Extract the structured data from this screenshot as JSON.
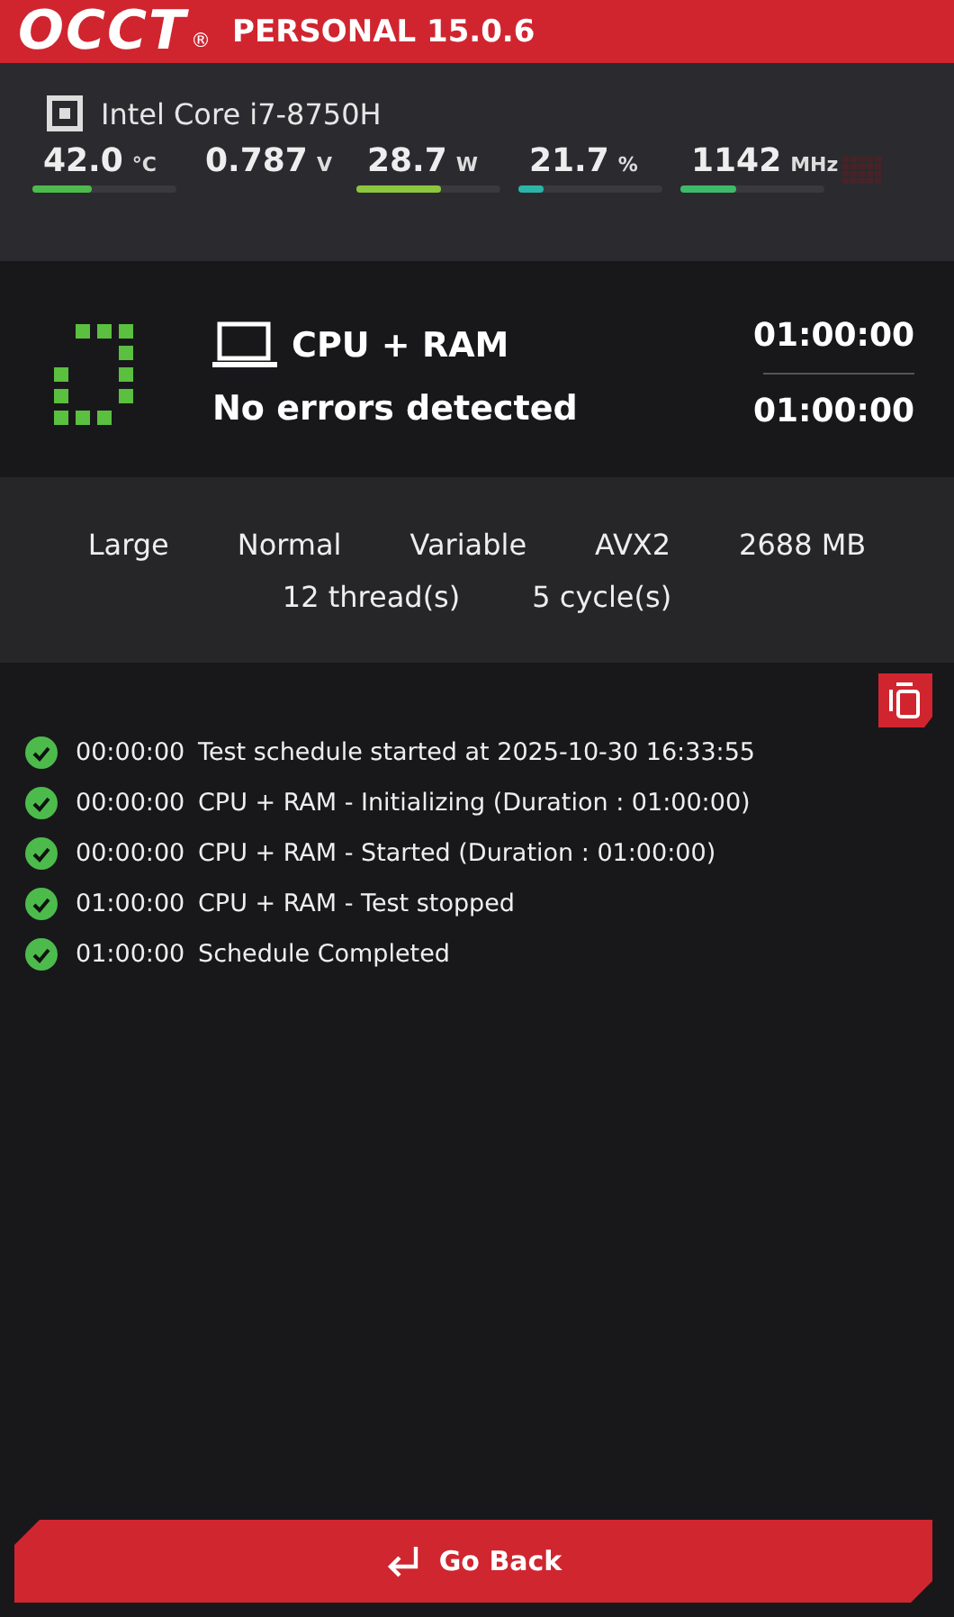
{
  "header": {
    "logo": "OCCT",
    "registered": "®",
    "edition": "PERSONAL 15.0.6"
  },
  "processor": {
    "name": "Intel Core i7-8750H"
  },
  "sensors": [
    {
      "value": "42.0",
      "unit": "°C",
      "level": 0.41,
      "color": "#4cbb4c"
    },
    {
      "value": "0.787",
      "unit": "V"
    },
    {
      "value": "28.7",
      "unit": "W",
      "level": 0.59,
      "color": "#8cc63f"
    },
    {
      "value": "21.7",
      "unit": "%",
      "level": 0.18,
      "color": "#2bb5a8"
    },
    {
      "value": "1142",
      "unit": "MHz",
      "level": 0.39,
      "color": "#3dba6a"
    }
  ],
  "test": {
    "name": "CPU + RAM",
    "status": "No errors detected",
    "elapsed": "01:00:00",
    "duration": "01:00:00"
  },
  "settings": {
    "row_1": [
      "Large",
      "Normal",
      "Variable",
      "AVX2",
      "2688 MB"
    ],
    "row_2": [
      "12 thread(s)",
      "5 cycle(s)"
    ]
  },
  "log": [
    {
      "time": "00:00:00",
      "message": "Test schedule started at 2025-10-30 16:33:55",
      "ok": true
    },
    {
      "time": "00:00:00",
      "message": "CPU + RAM - Initializing (Duration : 01:00:00)",
      "ok": true
    },
    {
      "time": "00:00:00",
      "message": "CPU + RAM - Started (Duration : 01:00:00)",
      "ok": true
    },
    {
      "time": "01:00:00",
      "message": "CPU + RAM - Test stopped",
      "ok": true
    },
    {
      "time": "01:00:00",
      "message": "Schedule Completed",
      "ok": true
    }
  ],
  "footer": {
    "button": "Go Back"
  }
}
